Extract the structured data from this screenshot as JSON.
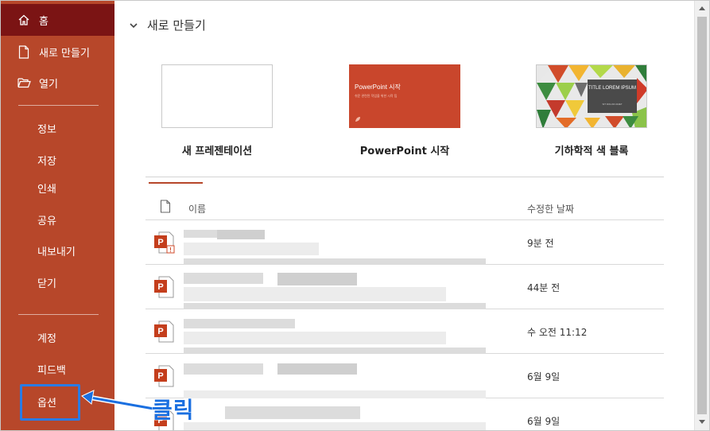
{
  "sidebar": {
    "items": [
      {
        "label": "홈",
        "icon": "home-icon"
      },
      {
        "label": "새로 만들기",
        "icon": "new-file-icon"
      },
      {
        "label": "열기",
        "icon": "open-folder-icon"
      },
      {
        "label": "정보"
      },
      {
        "label": "저장"
      },
      {
        "label": "인쇄"
      },
      {
        "label": "공유"
      },
      {
        "label": "내보내기"
      },
      {
        "label": "닫기"
      },
      {
        "label": "계정"
      },
      {
        "label": "피드백"
      },
      {
        "label": "옵션"
      }
    ]
  },
  "new_section": {
    "heading": "새로 만들기",
    "templates": [
      {
        "name": "새 프레젠테이션"
      },
      {
        "name": "PowerPoint 시작",
        "thumb_title": "PowerPoint 시작",
        "thumb_sub": "쉬운 관련된 작업을 위한 시작 팁"
      },
      {
        "name": "기하학적 색 블록",
        "thumb_title": "TITLE LOREM IPSUM",
        "thumb_sub": "SIT DOLOR AMET"
      }
    ]
  },
  "recent": {
    "col_name": "이름",
    "col_date": "수정한 날짜",
    "rows": [
      {
        "date": "9분 전"
      },
      {
        "date": "44분 전"
      },
      {
        "date": "수 오전 11:12"
      },
      {
        "date": "6월 9일"
      },
      {
        "date": "6월 9일"
      }
    ]
  },
  "annotation": {
    "label": "클릭"
  },
  "colors": {
    "sidebar": "#b7472a",
    "sidebar_active": "#7b1414",
    "highlight": "#2a7be4"
  }
}
